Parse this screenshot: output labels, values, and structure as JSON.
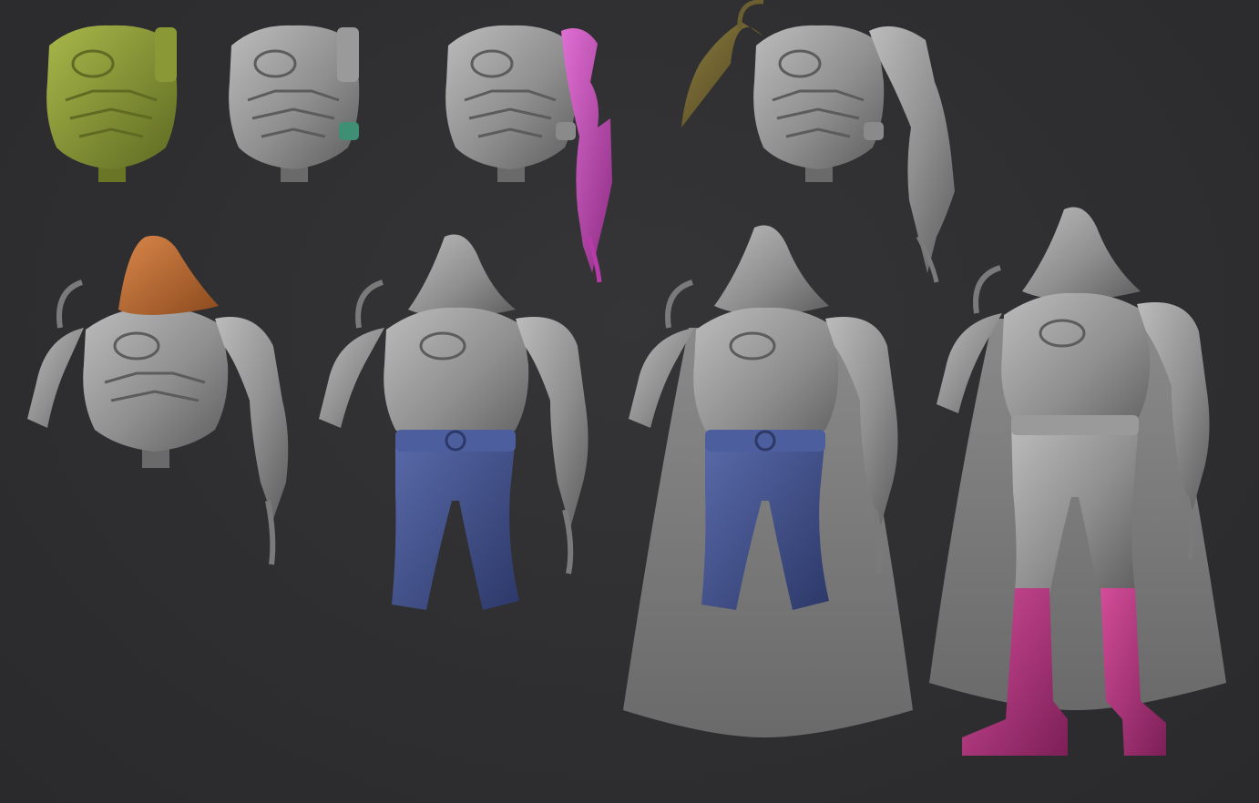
{
  "viewport": {
    "background": "#2f2f31",
    "panel_title": ""
  },
  "materials": {
    "clay_gray": "#8e8e8e",
    "clay_light": "#b4b4b4",
    "clay_dark": "#5c5c5c",
    "subtool_green": "#8e9a3a",
    "subtool_teal": "#3e8f73",
    "subtool_magenta": "#c547b8",
    "subtool_olive": "#6b5e30",
    "subtool_orange": "#b8682f",
    "subtool_blue": "#3f4f8c",
    "subtool_pink": "#b2337e"
  },
  "stages": [
    {
      "id": 1,
      "parts": [
        "torso"
      ],
      "highlight": "subtool_green"
    },
    {
      "id": 2,
      "parts": [
        "torso",
        "pouch"
      ],
      "highlight": "subtool_teal"
    },
    {
      "id": 3,
      "parts": [
        "torso",
        "right-arm"
      ],
      "highlight": "subtool_magenta"
    },
    {
      "id": 4,
      "parts": [
        "torso",
        "right-arm",
        "left-arm"
      ],
      "highlight": "subtool_olive"
    },
    {
      "id": 5,
      "parts": [
        "torso",
        "arms",
        "hood"
      ],
      "highlight": "subtool_orange"
    },
    {
      "id": 6,
      "parts": [
        "torso",
        "arms",
        "hood",
        "pants"
      ],
      "highlight": "subtool_blue"
    },
    {
      "id": 7,
      "parts": [
        "torso",
        "arms",
        "hood",
        "pants",
        "cape"
      ],
      "highlight": "subtool_blue"
    },
    {
      "id": 8,
      "parts": [
        "full-body",
        "cape",
        "boots"
      ],
      "highlight": "subtool_pink"
    }
  ]
}
